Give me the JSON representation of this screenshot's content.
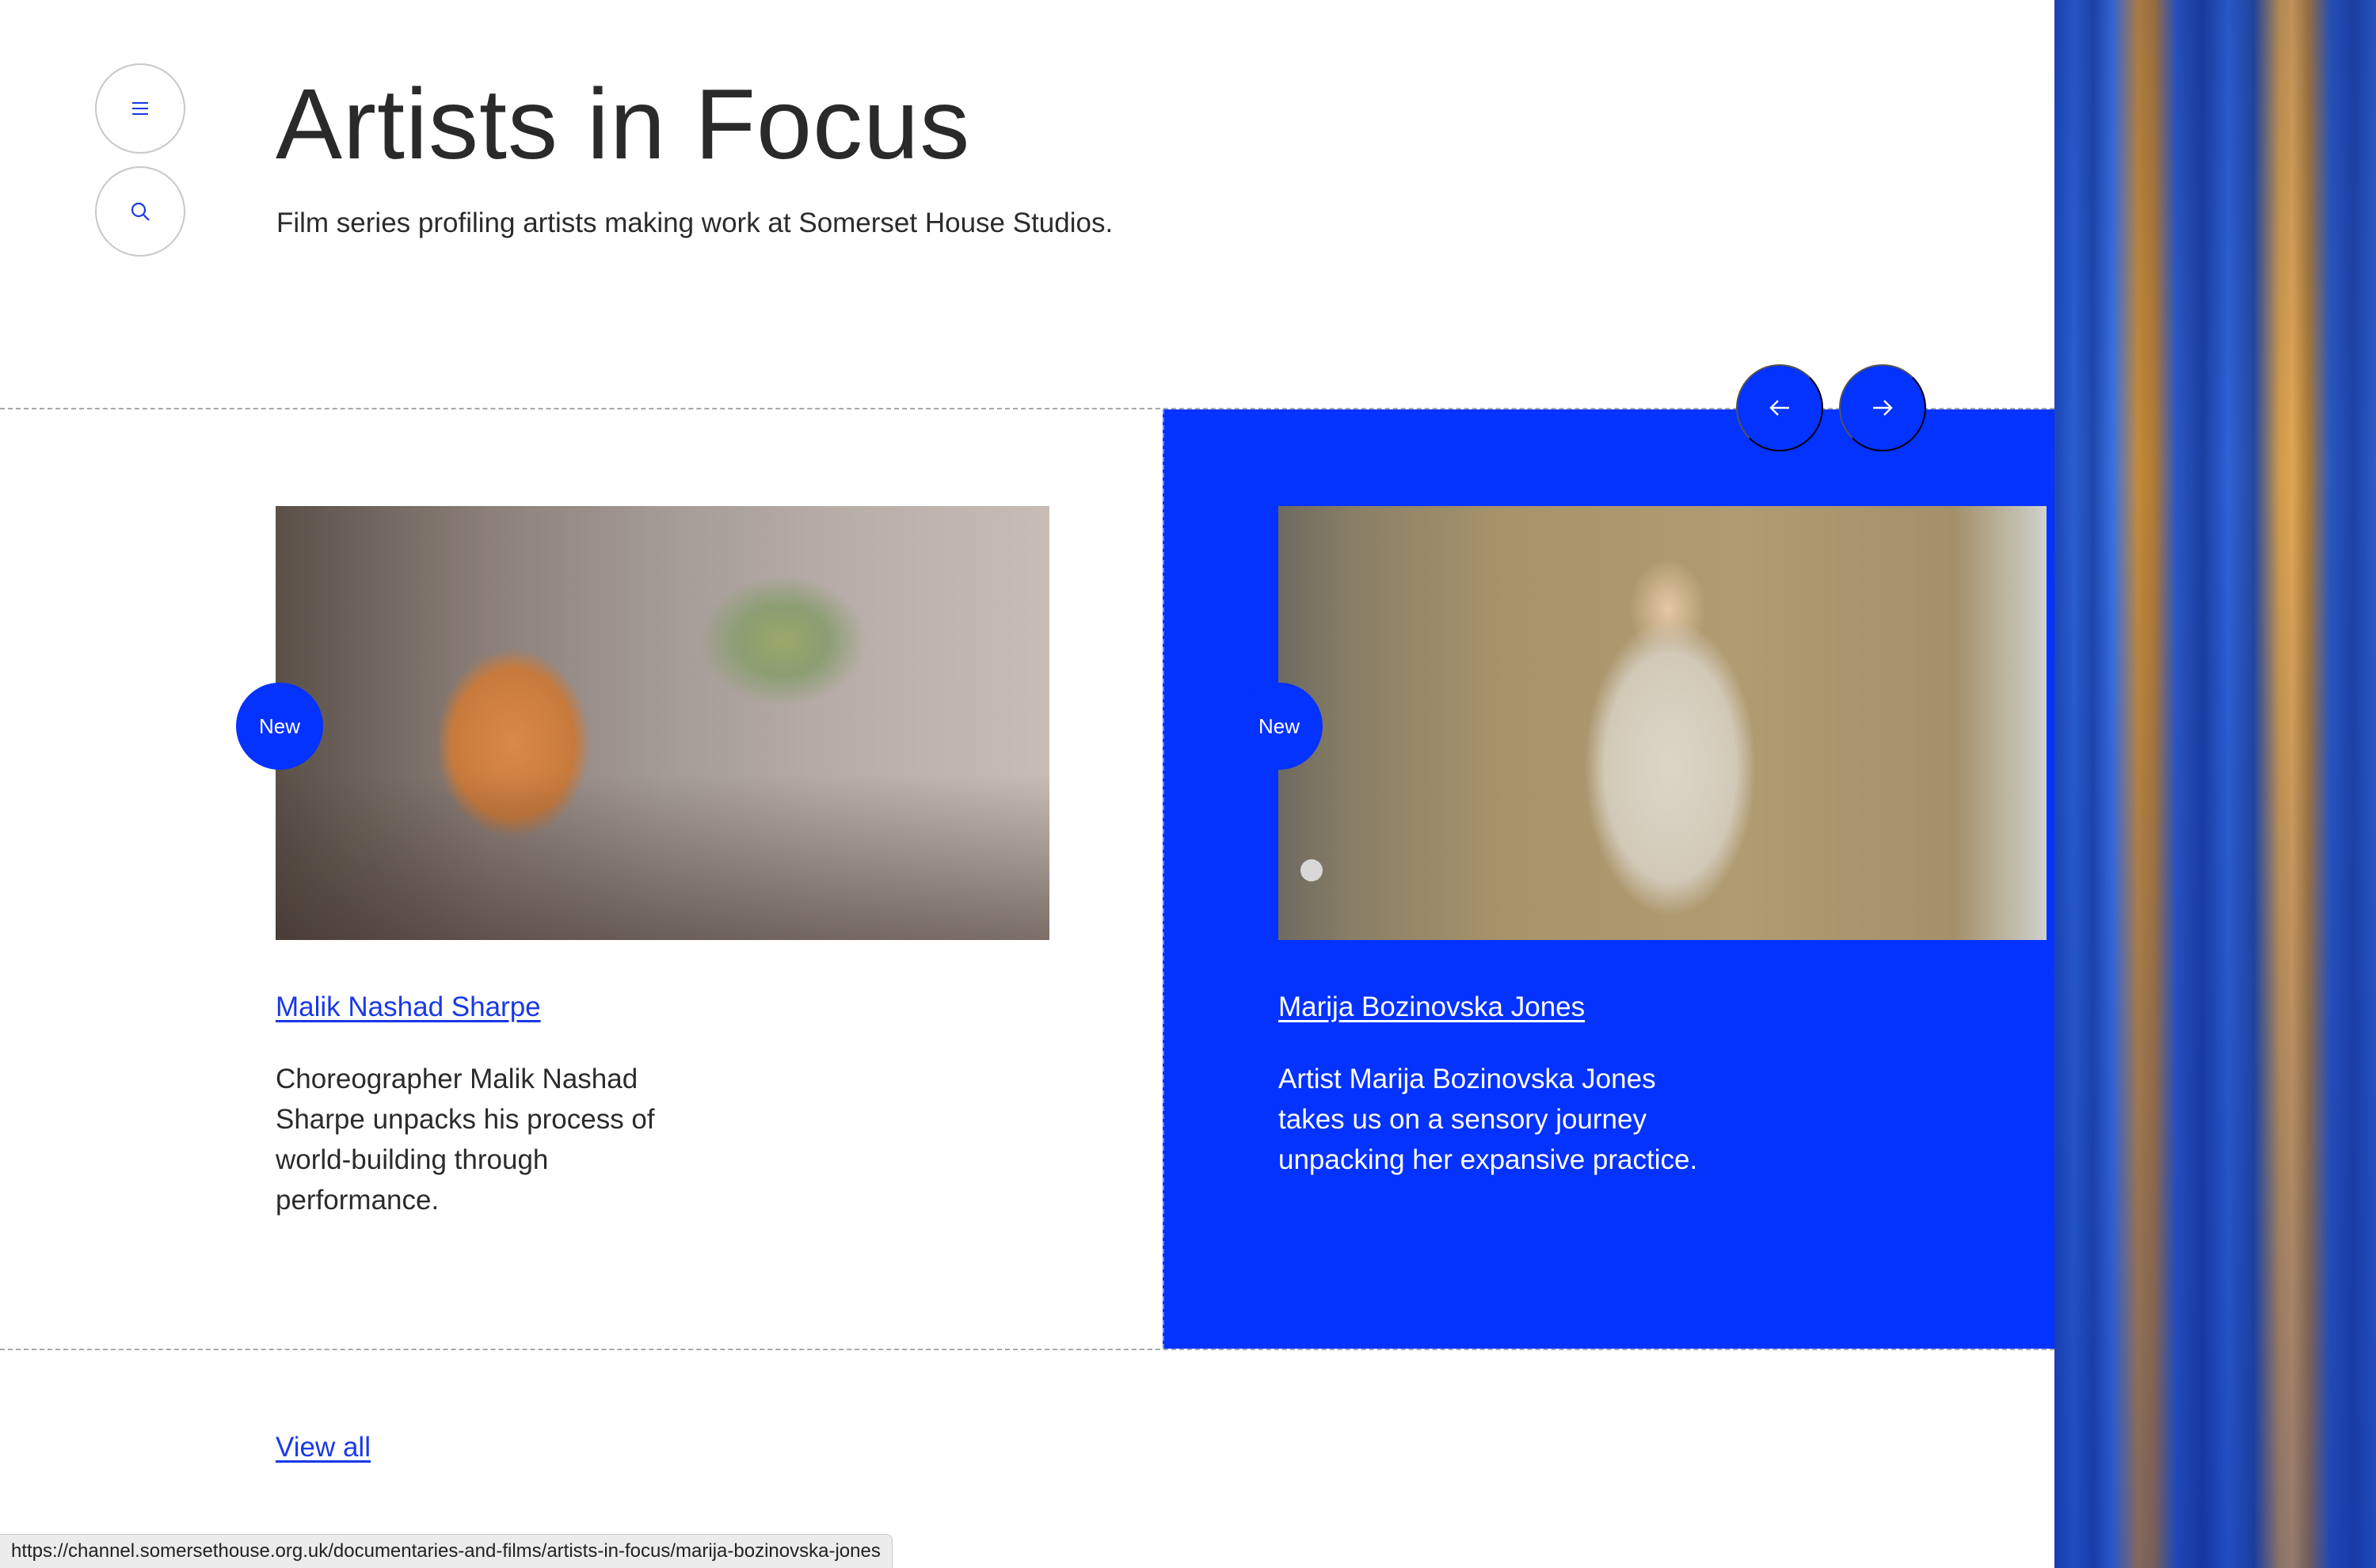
{
  "header": {
    "title": "Artists in Focus",
    "subtitle": "Film series profiling artists making work at Somerset House Studios."
  },
  "nav": {
    "menu_icon": "menu-icon",
    "search_icon": "search-icon",
    "prev_icon": "arrow-left-icon",
    "next_icon": "arrow-right-icon"
  },
  "cards": [
    {
      "badge": "New",
      "name": "Malik Nashad Sharpe",
      "description": "Choreographer Malik Nashad Sharpe unpacks his process of world-building through performance."
    },
    {
      "badge": "New",
      "name": "Marija Bozinovska Jones",
      "description": "Artist Marija Bozinovska Jones takes us on a sensory journey unpacking her expansive practice."
    }
  ],
  "footer": {
    "view_all": "View all"
  },
  "status_bar": {
    "url": "https://channel.somersethouse.org.uk/documentaries-and-films/artists-in-focus/marija-bozinovska-jones"
  },
  "colors": {
    "accent": "#0432ff",
    "link": "#1939e6",
    "text": "#2b2b2b"
  }
}
